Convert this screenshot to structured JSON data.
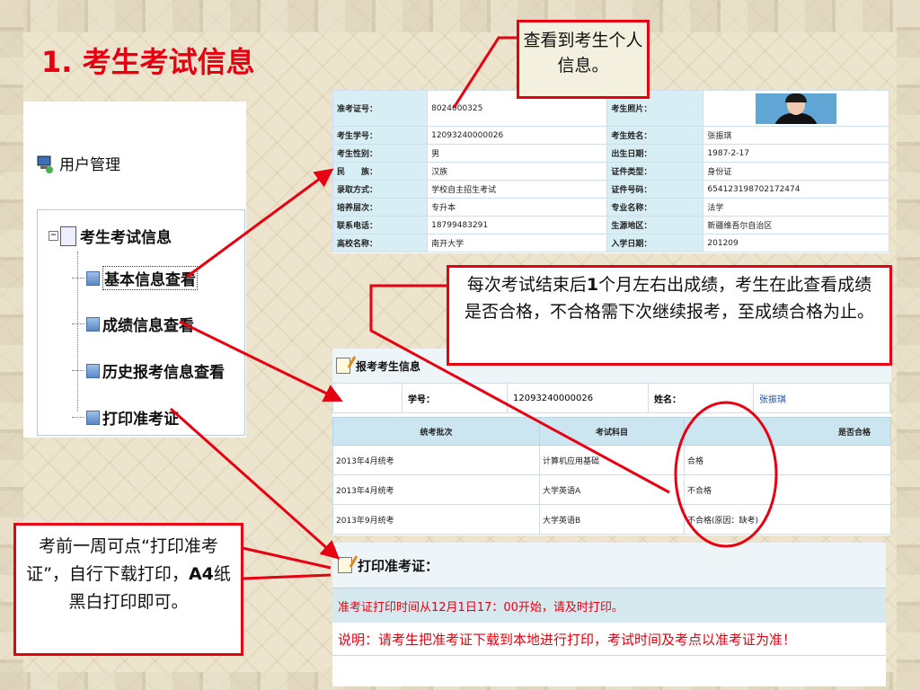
{
  "slide": {
    "title": "1. 考生考试信息"
  },
  "tree": {
    "user_management": "用户管理",
    "root": "考生考试信息",
    "items": [
      "基本信息查看",
      "成绩信息查看",
      "历史报考信息查看",
      "打印准考证"
    ]
  },
  "info": {
    "rows": [
      {
        "k1": "准考证号：",
        "v1": "8024000325",
        "k2": "考生照片：",
        "v2": ""
      },
      {
        "k1": "考生学号：",
        "v1": "12093240000026",
        "k2": "考生姓名：",
        "v2": "张振琪"
      },
      {
        "k1": "考生性别：",
        "v1": "男",
        "k2": "出生日期：",
        "v2": "1987-2-17"
      },
      {
        "k1": "民　　族：",
        "v1": "汉族",
        "k2": "证件类型：",
        "v2": "身份证"
      },
      {
        "k1": "录取方式：",
        "v1": "学校自主招生考试",
        "k2": "证件号码：",
        "v2": "654123198702172474"
      },
      {
        "k1": "培养层次：",
        "v1": "专升本",
        "k2": "专业名称：",
        "v2": "法学"
      },
      {
        "k1": "联系电话：",
        "v1": "18799483291",
        "k2": "生源地区：",
        "v2": "新疆维吾尔自治区"
      },
      {
        "k1": "高校名称：",
        "v1": "南开大学",
        "k2": "入学日期：",
        "v2": "201209"
      }
    ]
  },
  "scores": {
    "header": "报考考生信息",
    "id_label": "学号：",
    "id_value": "12093240000026",
    "name_label": "姓名：",
    "name_value": "张振琪",
    "columns": [
      "统考批次",
      "考试科目",
      "是否合格"
    ],
    "rows": [
      {
        "batch": "2013年4月统考",
        "subject": "计算机应用基础",
        "result": "合格",
        "red": false
      },
      {
        "batch": "2013年4月统考",
        "subject": "大学英语A",
        "result": "不合格",
        "red": true
      },
      {
        "batch": "2013年9月统考",
        "subject": "大学英语B",
        "result": "不合格(原因：缺考)",
        "red": true
      }
    ]
  },
  "print": {
    "header": "打印准考证：",
    "notice": "准考证打印时间从12月1日17：00开始，请及时打印。",
    "note": "说明：请考生把准考证下载到本地进行打印，考试时间及考点以准考证为准！"
  },
  "callouts": {
    "c1": "查看到考生个人信息。",
    "c2_pre": "每次考试结束后",
    "c2_bold": "1",
    "c2_post": "个月左右出成绩，考生在此查看成绩是否合格，不合格需下次继续报考，至成绩合格为止。",
    "c3_pre": "考前一周可点“打印准考证”，自行下载打印，",
    "c3_bold": "A4",
    "c3_post": "纸黑白打印即可。"
  },
  "colors": {
    "accent": "#e60012"
  }
}
